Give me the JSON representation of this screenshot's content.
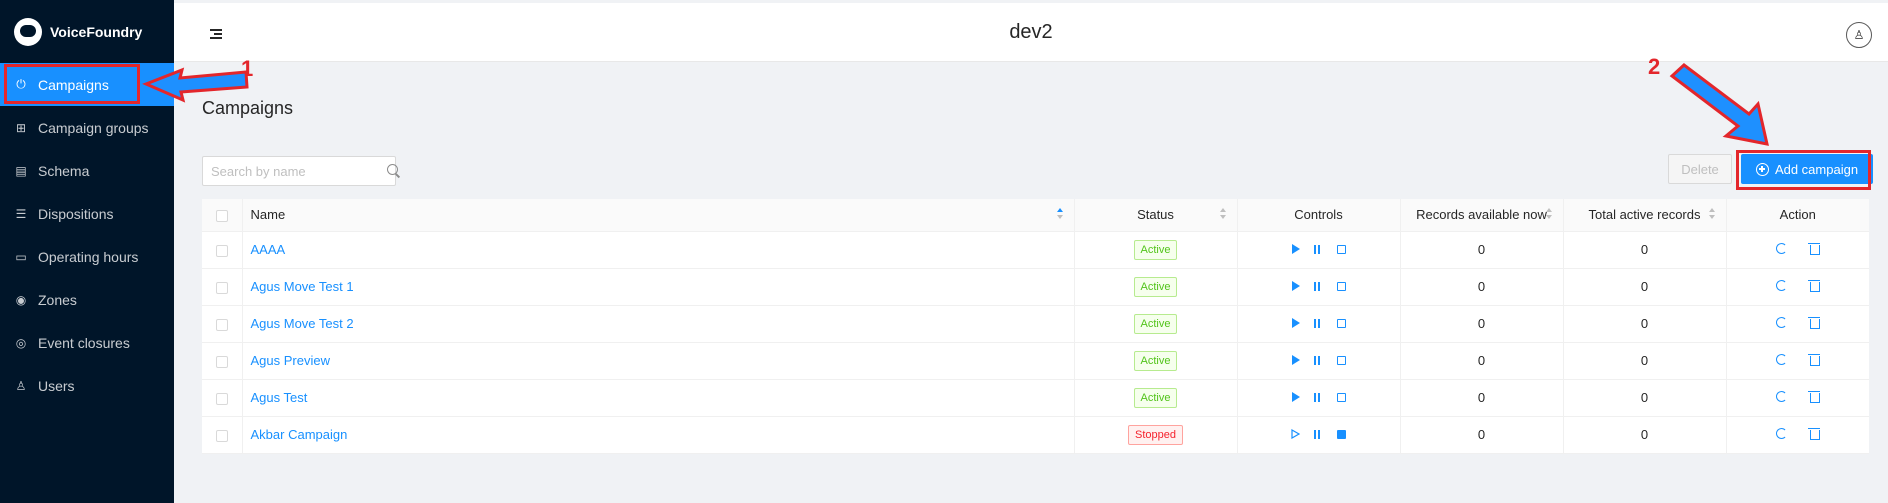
{
  "app": {
    "name": "VoiceFoundry"
  },
  "sidebar": {
    "items": [
      {
        "label": "Campaigns",
        "icon": "power-icon",
        "active": true
      },
      {
        "label": "Campaign groups",
        "icon": "group-icon",
        "active": false
      },
      {
        "label": "Schema",
        "icon": "schema-icon",
        "active": false
      },
      {
        "label": "Dispositions",
        "icon": "list-icon",
        "active": false
      },
      {
        "label": "Operating hours",
        "icon": "calendar-icon",
        "active": false
      },
      {
        "label": "Zones",
        "icon": "location-icon",
        "active": false
      },
      {
        "label": "Event closures",
        "icon": "event-icon",
        "active": false
      },
      {
        "label": "Users",
        "icon": "user-icon",
        "active": false
      }
    ]
  },
  "header": {
    "title": "dev2"
  },
  "page": {
    "title": "Campaigns",
    "search_placeholder": "Search by name",
    "delete_label": "Delete",
    "add_label": "Add campaign"
  },
  "table": {
    "columns": {
      "name": "Name",
      "status": "Status",
      "controls": "Controls",
      "records_available": "Records available now",
      "total_active": "Total active records",
      "action": "Action"
    },
    "rows": [
      {
        "name": "AAAA",
        "status": "Active",
        "records_available": "0",
        "total_active": "0"
      },
      {
        "name": "Agus Move Test 1",
        "status": "Active",
        "records_available": "0",
        "total_active": "0"
      },
      {
        "name": "Agus Move Test 2",
        "status": "Active",
        "records_available": "0",
        "total_active": "0"
      },
      {
        "name": "Agus Preview",
        "status": "Active",
        "records_available": "0",
        "total_active": "0"
      },
      {
        "name": "Agus Test",
        "status": "Active",
        "records_available": "0",
        "total_active": "0"
      },
      {
        "name": "Akbar Campaign",
        "status": "Stopped",
        "records_available": "0",
        "total_active": "0"
      }
    ]
  },
  "annotations": {
    "one": "1",
    "two": "2"
  },
  "colors": {
    "accent": "#1890ff",
    "sidebar": "#001529",
    "annotation": "#e3262b"
  }
}
